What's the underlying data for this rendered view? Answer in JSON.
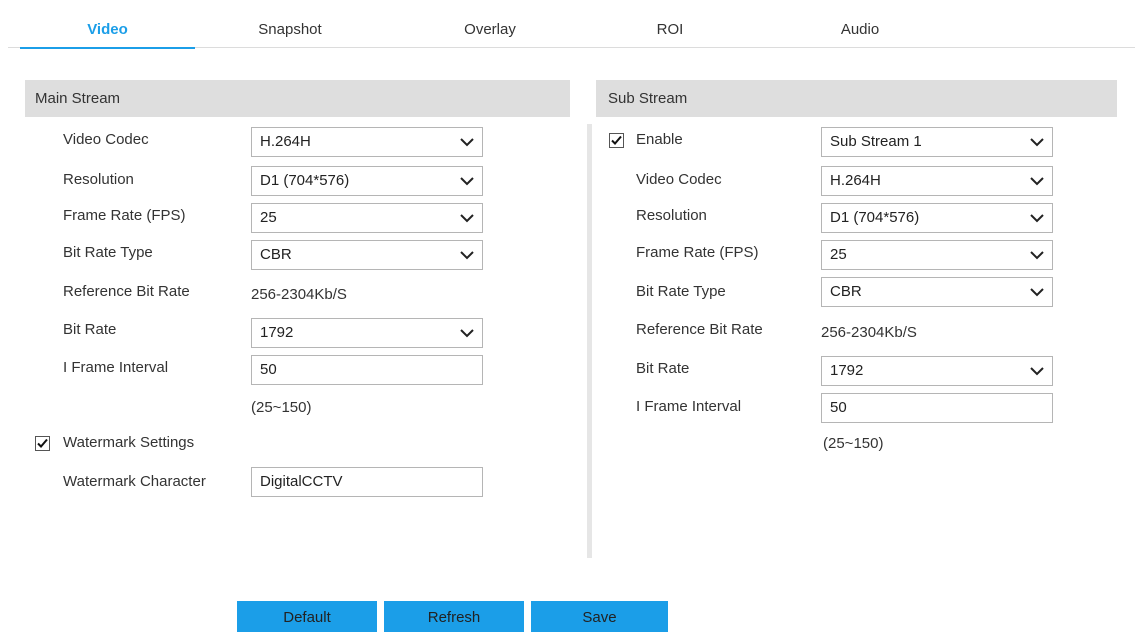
{
  "tabs": [
    {
      "label": "Video",
      "active": true
    },
    {
      "label": "Snapshot"
    },
    {
      "label": "Overlay"
    },
    {
      "label": "ROI"
    },
    {
      "label": "Audio"
    }
  ],
  "main_stream": {
    "header": "Main Stream",
    "video_codec": {
      "label": "Video Codec",
      "value": "H.264H"
    },
    "resolution": {
      "label": "Resolution",
      "value": "D1 (704*576)"
    },
    "frame_rate": {
      "label": "Frame Rate (FPS)",
      "value": "25"
    },
    "bit_rate_type": {
      "label": "Bit Rate Type",
      "value": "CBR"
    },
    "reference_bit_rate": {
      "label": "Reference Bit Rate",
      "value": "256-2304Kb/S"
    },
    "bit_rate": {
      "label": "Bit Rate",
      "value": "1792"
    },
    "i_frame_interval": {
      "label": "I Frame Interval",
      "value": "50",
      "range": "(25~150)"
    },
    "watermark_settings": {
      "label": "Watermark Settings",
      "checked": true
    },
    "watermark_character": {
      "label": "Watermark Character",
      "value": "DigitalCCTV"
    }
  },
  "sub_stream": {
    "header": "Sub Stream",
    "enable": {
      "label": "Enable",
      "checked": true,
      "value": "Sub Stream 1"
    },
    "video_codec": {
      "label": "Video Codec",
      "value": "H.264H"
    },
    "resolution": {
      "label": "Resolution",
      "value": "D1 (704*576)"
    },
    "frame_rate": {
      "label": "Frame Rate (FPS)",
      "value": "25"
    },
    "bit_rate_type": {
      "label": "Bit Rate Type",
      "value": "CBR"
    },
    "reference_bit_rate": {
      "label": "Reference Bit Rate",
      "value": "256-2304Kb/S"
    },
    "bit_rate": {
      "label": "Bit Rate",
      "value": "1792"
    },
    "i_frame_interval": {
      "label": "I Frame Interval",
      "value": "50",
      "range": "(25~150)"
    }
  },
  "buttons": {
    "default": "Default",
    "refresh": "Refresh",
    "save": "Save"
  },
  "colors": {
    "accent": "#1b9ee8",
    "section_header_bg": "#dedede"
  }
}
